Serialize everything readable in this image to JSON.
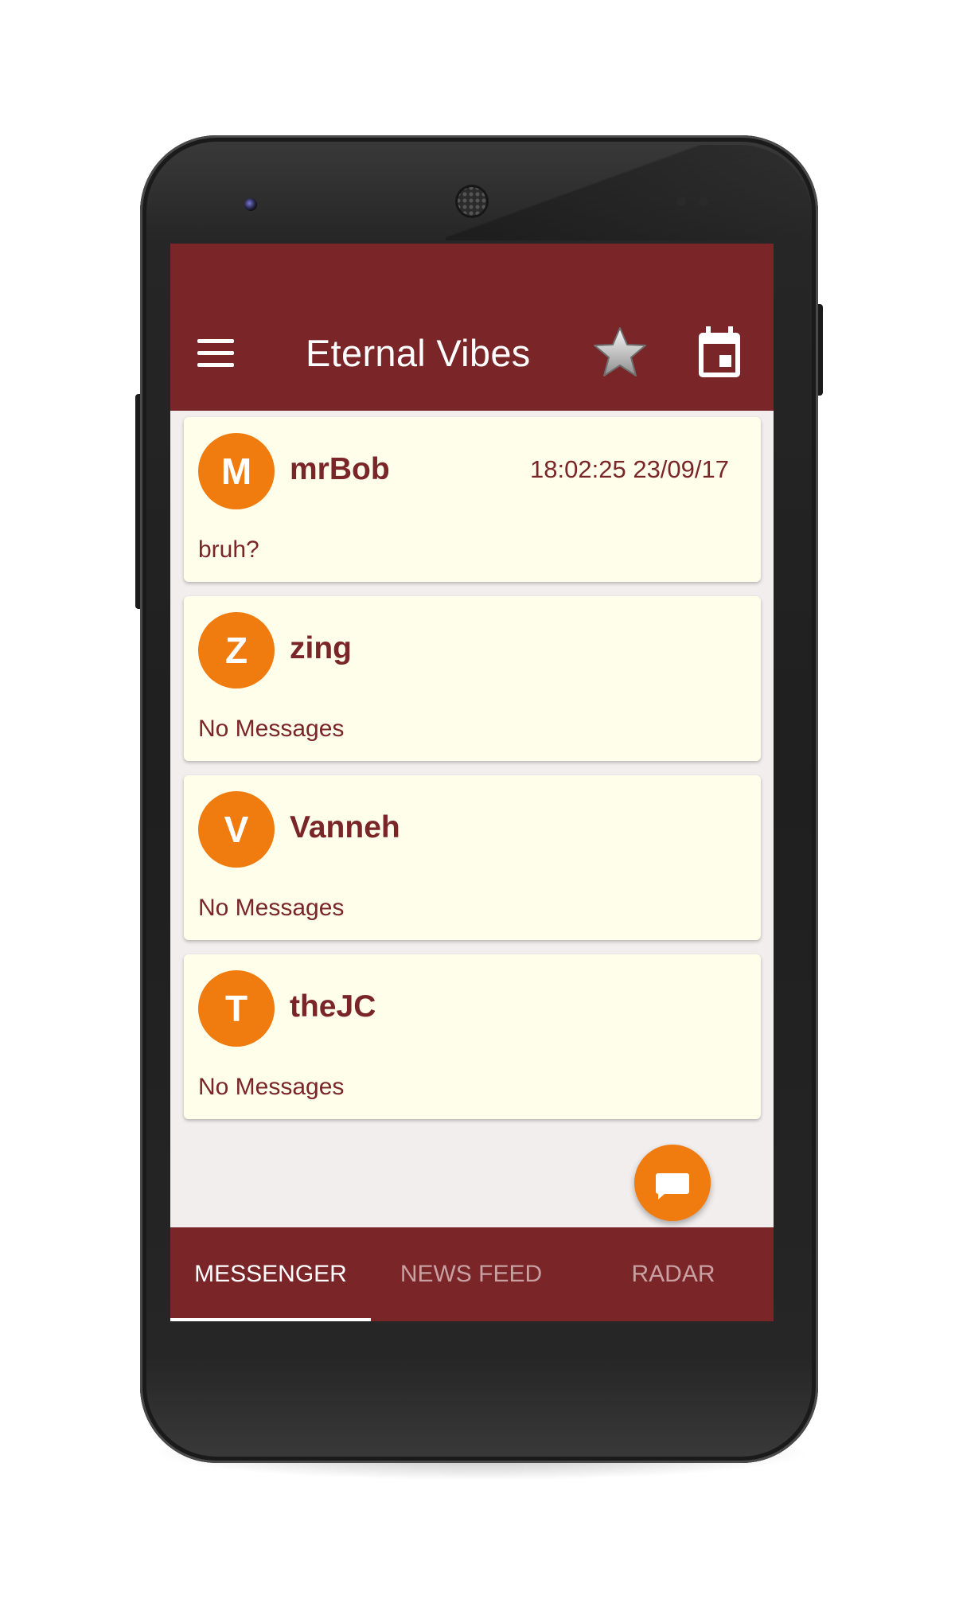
{
  "app": {
    "title": "Eternal Vibes",
    "colors": {
      "primary": "#7a2528",
      "accent": "#f07b0f",
      "card_background": "#fffeea",
      "screen_background": "#f2eeee"
    }
  },
  "toolbar": {
    "menu_icon": "hamburger-menu-icon",
    "favorites_icon": "star-icon",
    "calendar_icon": "calendar-icon"
  },
  "conversations": [
    {
      "initial": "M",
      "name": "mrBob",
      "timestamp": "18:02:25 23/09/17",
      "preview": "bruh?"
    },
    {
      "initial": "Z",
      "name": "zing",
      "timestamp": "",
      "preview": "No Messages"
    },
    {
      "initial": "V",
      "name": "Vanneh",
      "timestamp": "",
      "preview": "No Messages"
    },
    {
      "initial": "T",
      "name": "theJC",
      "timestamp": "",
      "preview": "No Messages"
    }
  ],
  "fab": {
    "icon": "message-icon"
  },
  "tabs": [
    {
      "label": "MESSENGER",
      "active": true
    },
    {
      "label": "NEWS FEED",
      "active": false
    },
    {
      "label": "RADAR",
      "active": false
    }
  ]
}
